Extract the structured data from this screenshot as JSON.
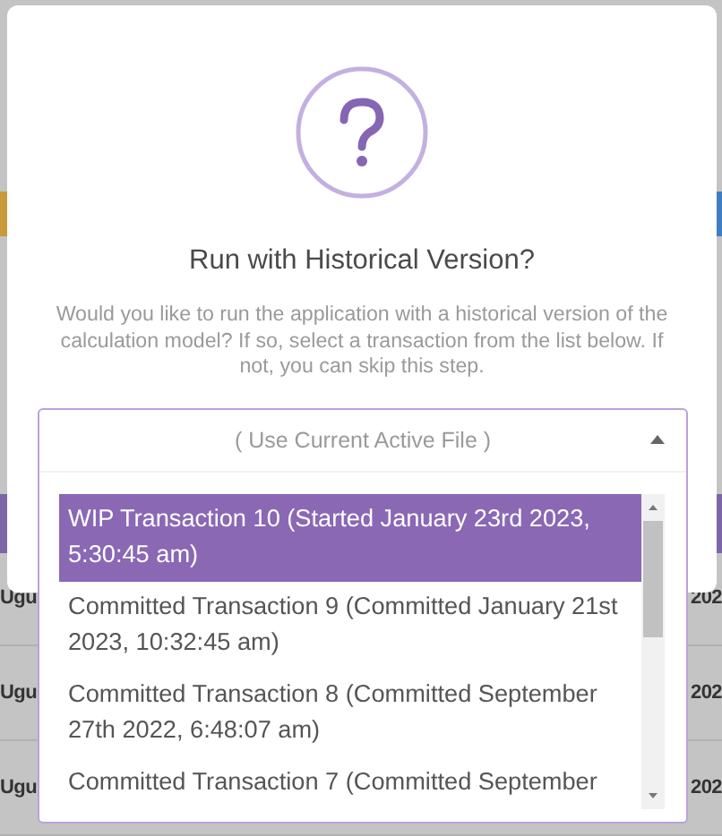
{
  "background_table": {
    "rows": [
      {
        "column_1": "Ugu",
        "column_2": "202"
      },
      {
        "column_1": "Ugu",
        "column_2": "202"
      },
      {
        "column_1": "Ugu",
        "column_2": "202"
      }
    ]
  },
  "dialog": {
    "title": "Run with Historical Version?",
    "message": "Would you like to run the application with a historical version of the calculation model? If so, select a transaction from the list below. If not, you can skip this step.",
    "dropdown": {
      "value": "( Use Current Active File )",
      "expanded": true,
      "options": [
        {
          "label": "WIP Transaction 10 (Started January 23rd 2023, 5:30:45 am)",
          "selected": true
        },
        {
          "label": "Committed Transaction 9 (Committed January 21st 2023, 10:32:45 am)",
          "selected": false
        },
        {
          "label": "Committed Transaction 8 (Committed September 27th 2022, 6:48:07 am)",
          "selected": false
        },
        {
          "label": "Committed Transaction 7 (Committed September",
          "selected": false
        }
      ]
    }
  }
}
